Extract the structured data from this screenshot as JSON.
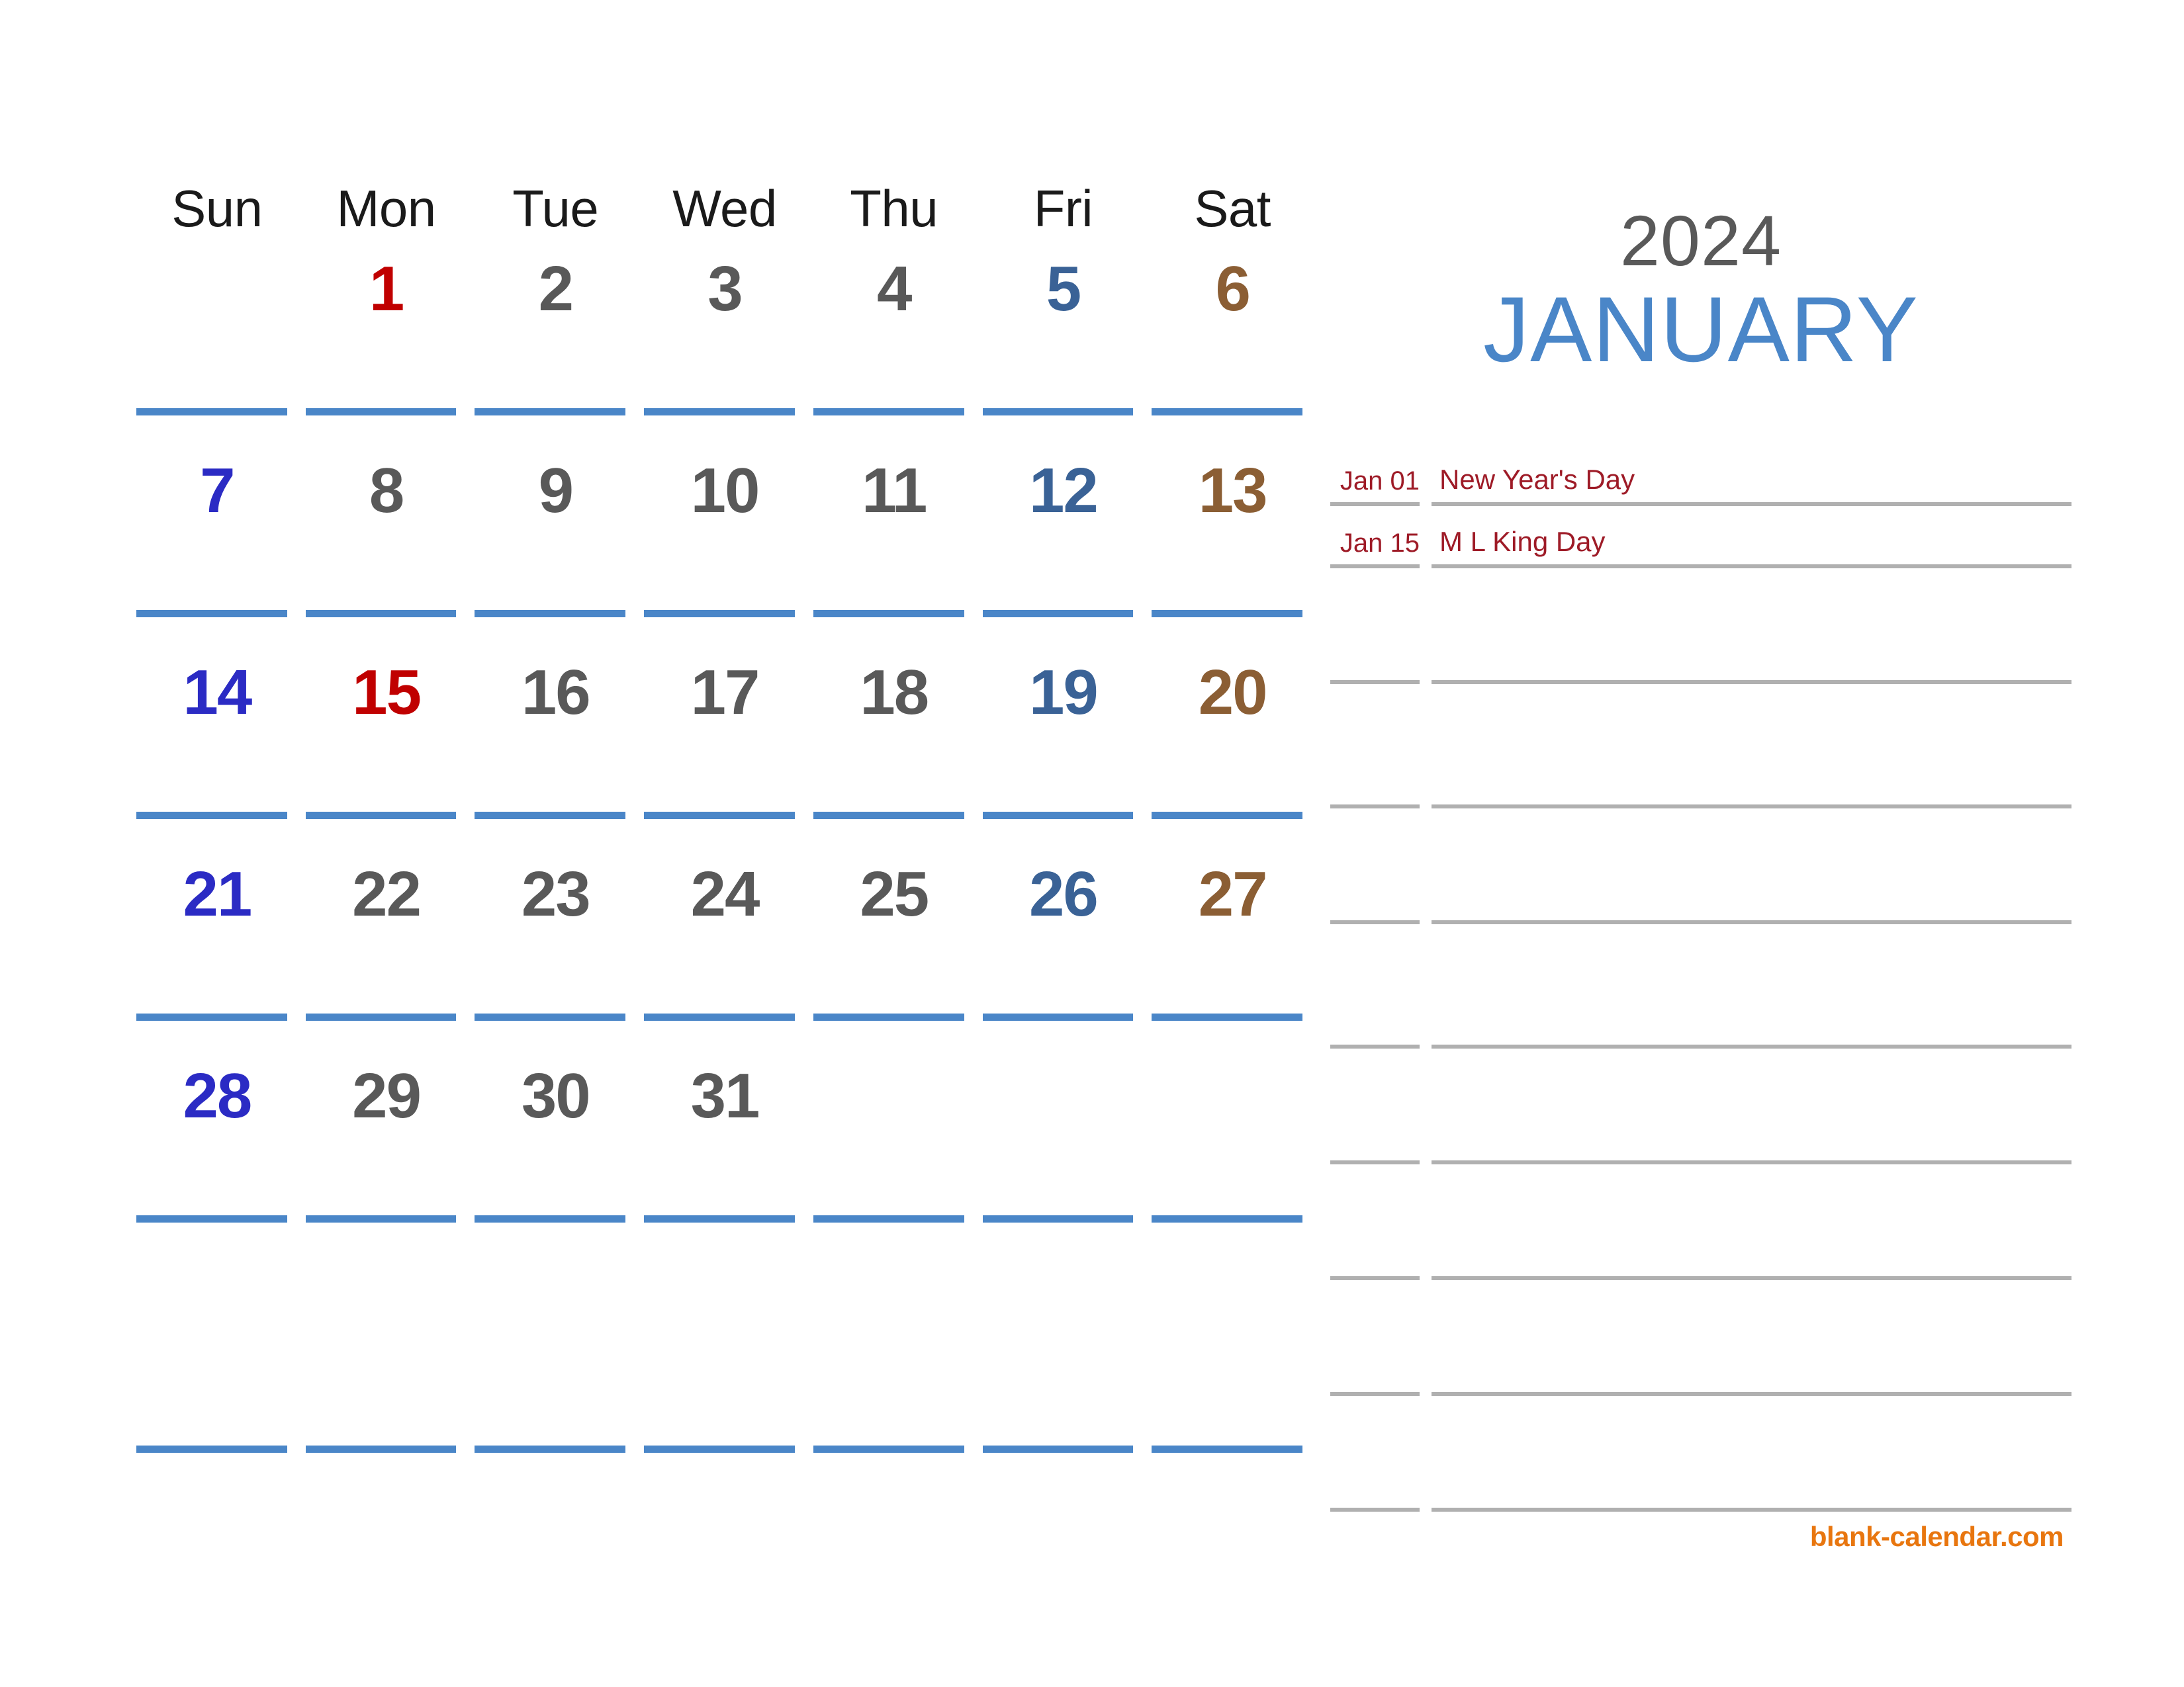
{
  "title": {
    "year": "2024",
    "month": "JANUARY"
  },
  "weekdays": [
    {
      "label": "Sun"
    },
    {
      "label": "Mon"
    },
    {
      "label": "Tue"
    },
    {
      "label": "Wed"
    },
    {
      "label": "Thu"
    },
    {
      "label": "Fri"
    },
    {
      "label": "Sat"
    }
  ],
  "weeks": [
    [
      {
        "num": "",
        "kind": "empty"
      },
      {
        "num": "1",
        "kind": "holiday"
      },
      {
        "num": "2",
        "kind": "weekday"
      },
      {
        "num": "3",
        "kind": "weekday"
      },
      {
        "num": "4",
        "kind": "weekday"
      },
      {
        "num": "5",
        "kind": "friday"
      },
      {
        "num": "6",
        "kind": "saturday"
      }
    ],
    [
      {
        "num": "7",
        "kind": "sunday"
      },
      {
        "num": "8",
        "kind": "weekday"
      },
      {
        "num": "9",
        "kind": "weekday"
      },
      {
        "num": "10",
        "kind": "weekday"
      },
      {
        "num": "11",
        "kind": "weekday"
      },
      {
        "num": "12",
        "kind": "friday"
      },
      {
        "num": "13",
        "kind": "saturday"
      }
    ],
    [
      {
        "num": "14",
        "kind": "sunday"
      },
      {
        "num": "15",
        "kind": "holiday"
      },
      {
        "num": "16",
        "kind": "weekday"
      },
      {
        "num": "17",
        "kind": "weekday"
      },
      {
        "num": "18",
        "kind": "weekday"
      },
      {
        "num": "19",
        "kind": "friday"
      },
      {
        "num": "20",
        "kind": "saturday"
      }
    ],
    [
      {
        "num": "21",
        "kind": "sunday"
      },
      {
        "num": "22",
        "kind": "weekday"
      },
      {
        "num": "23",
        "kind": "weekday"
      },
      {
        "num": "24",
        "kind": "weekday"
      },
      {
        "num": "25",
        "kind": "weekday"
      },
      {
        "num": "26",
        "kind": "friday"
      },
      {
        "num": "27",
        "kind": "saturday"
      }
    ],
    [
      {
        "num": "28",
        "kind": "sunday"
      },
      {
        "num": "29",
        "kind": "weekday"
      },
      {
        "num": "30",
        "kind": "weekday"
      },
      {
        "num": "31",
        "kind": "weekday"
      },
      {
        "num": "",
        "kind": "empty"
      },
      {
        "num": "",
        "kind": "empty"
      },
      {
        "num": "",
        "kind": "empty"
      }
    ],
    [
      {
        "num": "",
        "kind": "empty"
      },
      {
        "num": "",
        "kind": "empty"
      },
      {
        "num": "",
        "kind": "empty"
      },
      {
        "num": "",
        "kind": "empty"
      },
      {
        "num": "",
        "kind": "empty"
      },
      {
        "num": "",
        "kind": "empty"
      },
      {
        "num": "",
        "kind": "empty"
      }
    ]
  ],
  "notes": [
    {
      "date": "Jan 01",
      "text": "New Year's Day"
    },
    {
      "date": "Jan 15",
      "text": "M L King Day"
    },
    {
      "date": "",
      "text": ""
    },
    {
      "date": "",
      "text": ""
    },
    {
      "date": "",
      "text": ""
    },
    {
      "date": "",
      "text": ""
    },
    {
      "date": "",
      "text": ""
    },
    {
      "date": "",
      "text": ""
    },
    {
      "date": "",
      "text": ""
    },
    {
      "date": "",
      "text": ""
    }
  ],
  "brand": "blank-calendar.com",
  "colors": {
    "weekday": "#595959",
    "sunday": "#2b2bc4",
    "friday": "#3a6296",
    "saturday": "#8b5e34",
    "holiday": "#c00000",
    "rule_blue": "#4a86c8",
    "rule_gray": "#b0b0b0",
    "month_blue": "#4a86c8",
    "note_red": "#9e1b27",
    "brand_orange": "#e8760f"
  }
}
